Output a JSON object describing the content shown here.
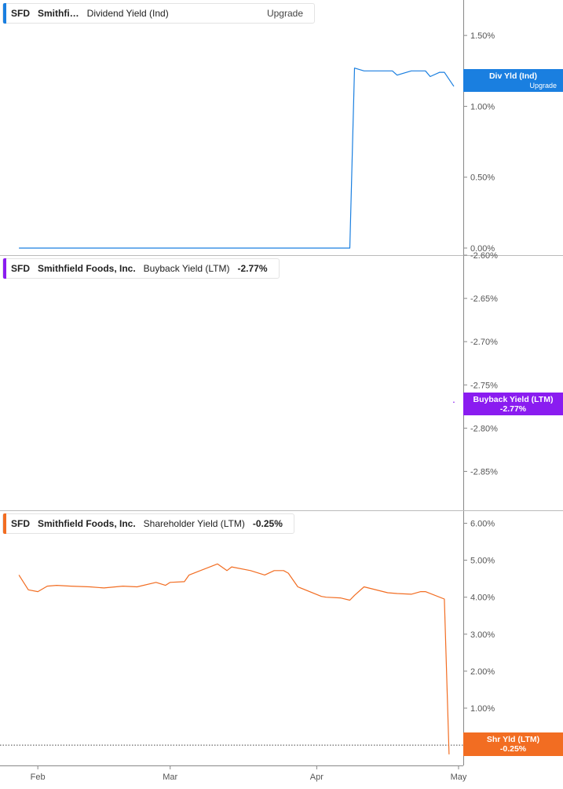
{
  "colors": {
    "dividend": "#1a7fe0",
    "buyback": "#8a1cf0",
    "shareholder": "#f26d22",
    "axis": "#555555",
    "grid": "#9a9a9a"
  },
  "panels": {
    "dividend": {
      "ticker": "SFD",
      "company": "Smithfi…",
      "metric": "Dividend Yield (Ind)",
      "action": "Upgrade",
      "badge_label": "Div Yld (Ind)",
      "badge_sub": "Upgrade"
    },
    "buyback": {
      "ticker": "SFD",
      "company": "Smithfield Foods, Inc.",
      "metric": "Buyback Yield (LTM)",
      "value": "-2.77%",
      "badge_label": "Buyback Yield (LTM)",
      "badge_value": "-2.77%"
    },
    "shareholder": {
      "ticker": "SFD",
      "company": "Smithfield Foods, Inc.",
      "metric": "Shareholder Yield (LTM)",
      "value": "-0.25%",
      "badge_label": "Shr Yld (LTM)",
      "badge_value": "-0.25%"
    }
  },
  "chart_data": [
    {
      "type": "line",
      "title": "Dividend Yield (Ind)",
      "x": [
        "2025-01-28",
        "2025-02-05",
        "2025-02-15",
        "2025-02-25",
        "2025-03-05",
        "2025-03-15",
        "2025-03-25",
        "2025-04-04",
        "2025-04-08",
        "2025-04-09",
        "2025-04-11",
        "2025-04-14",
        "2025-04-17",
        "2025-04-18",
        "2025-04-21",
        "2025-04-24",
        "2025-04-25",
        "2025-04-27",
        "2025-04-28",
        "2025-04-30"
      ],
      "series": [
        {
          "name": "Div Yld (Ind)",
          "values": [
            0,
            0,
            0,
            0,
            0,
            0,
            0,
            0,
            0,
            1.27,
            1.25,
            1.25,
            1.25,
            1.22,
            1.25,
            1.25,
            1.21,
            1.24,
            1.24,
            1.14
          ]
        }
      ],
      "ylim": [
        -0.05,
        1.75
      ],
      "y_ticks": [
        "0.00%",
        "0.50%",
        "1.00%",
        "1.50%"
      ],
      "y_tick_values": [
        0,
        0.5,
        1.0,
        1.5
      ]
    },
    {
      "type": "line",
      "title": "Buyback Yield (LTM)",
      "x": [
        "2025-04-30"
      ],
      "series": [
        {
          "name": "Buyback Yield (LTM)",
          "values": [
            -2.77
          ]
        }
      ],
      "ylim": [
        -2.895,
        -2.6
      ],
      "y_ticks": [
        "-2.60%",
        "-2.65%",
        "-2.70%",
        "-2.75%",
        "-2.80%",
        "-2.85%"
      ],
      "y_tick_values": [
        -2.6,
        -2.65,
        -2.7,
        -2.75,
        -2.8,
        -2.85
      ]
    },
    {
      "type": "line",
      "title": "Shareholder Yield (LTM)",
      "x": [
        "2025-01-28",
        "2025-01-30",
        "2025-02-01",
        "2025-02-03",
        "2025-02-05",
        "2025-02-08",
        "2025-02-12",
        "2025-02-15",
        "2025-02-19",
        "2025-02-22",
        "2025-02-26",
        "2025-02-28",
        "2025-03-01",
        "2025-03-04",
        "2025-03-05",
        "2025-03-07",
        "2025-03-10",
        "2025-03-11",
        "2025-03-13",
        "2025-03-14",
        "2025-03-18",
        "2025-03-21",
        "2025-03-23",
        "2025-03-25",
        "2025-03-26",
        "2025-03-28",
        "2025-04-02",
        "2025-04-03",
        "2025-04-06",
        "2025-04-08",
        "2025-04-09",
        "2025-04-11",
        "2025-04-16",
        "2025-04-18",
        "2025-04-21",
        "2025-04-23",
        "2025-04-24",
        "2025-04-28",
        "2025-04-29"
      ],
      "series": [
        {
          "name": "Shr Yld (LTM)",
          "values": [
            4.6,
            4.2,
            4.15,
            4.3,
            4.32,
            4.3,
            4.28,
            4.25,
            4.3,
            4.28,
            4.4,
            4.32,
            4.4,
            4.42,
            4.6,
            4.7,
            4.85,
            4.9,
            4.72,
            4.82,
            4.72,
            4.6,
            4.72,
            4.72,
            4.65,
            4.28,
            4.02,
            4.0,
            3.98,
            3.92,
            4.05,
            4.28,
            4.12,
            4.1,
            4.08,
            4.15,
            4.15,
            3.95,
            -0.25
          ]
        }
      ],
      "ylim": [
        -0.55,
        6.35
      ],
      "y_ticks": [
        "0.00%",
        "1.00%",
        "2.00%",
        "3.00%",
        "4.00%",
        "5.00%",
        "6.00%"
      ],
      "y_tick_values": [
        0,
        1,
        2,
        3,
        4,
        5,
        6
      ]
    }
  ],
  "x_axis": {
    "range": [
      "2025-01-24",
      "2025-05-02"
    ],
    "labels": [
      {
        "date": "2025-02-01",
        "text": "Feb"
      },
      {
        "date": "2025-03-01",
        "text": "Mar"
      },
      {
        "date": "2025-04-01",
        "text": "Apr"
      },
      {
        "date": "2025-05-01",
        "text": "May"
      }
    ]
  }
}
